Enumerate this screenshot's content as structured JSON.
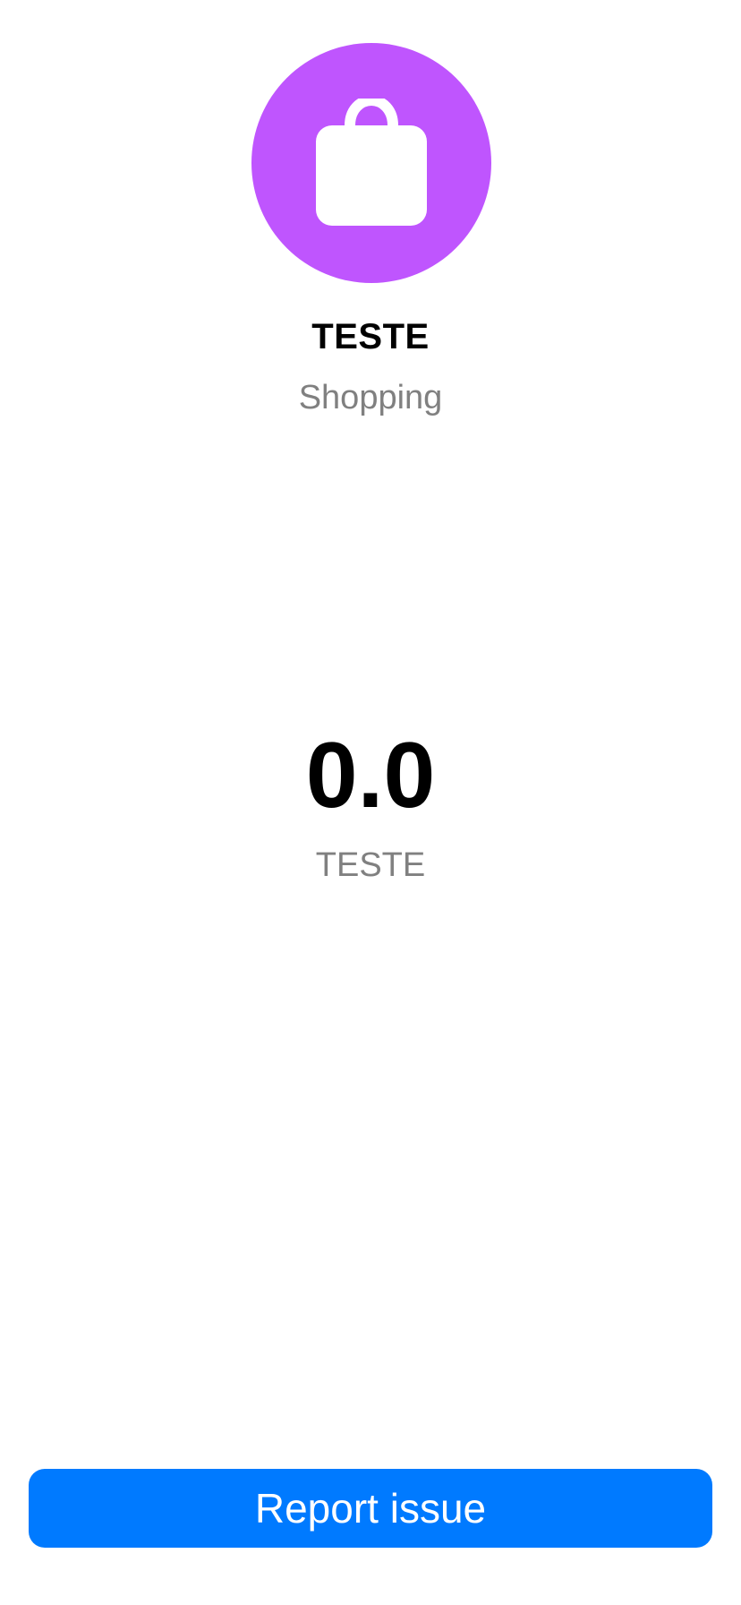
{
  "merchant": {
    "name": "TESTE",
    "category": "Shopping",
    "icon": "shopping-bag-icon",
    "icon_bg_color": "#bf55fe"
  },
  "amount": {
    "value": "0.0",
    "label": "TESTE"
  },
  "actions": {
    "report_label": "Report issue",
    "report_color": "#007aff"
  }
}
